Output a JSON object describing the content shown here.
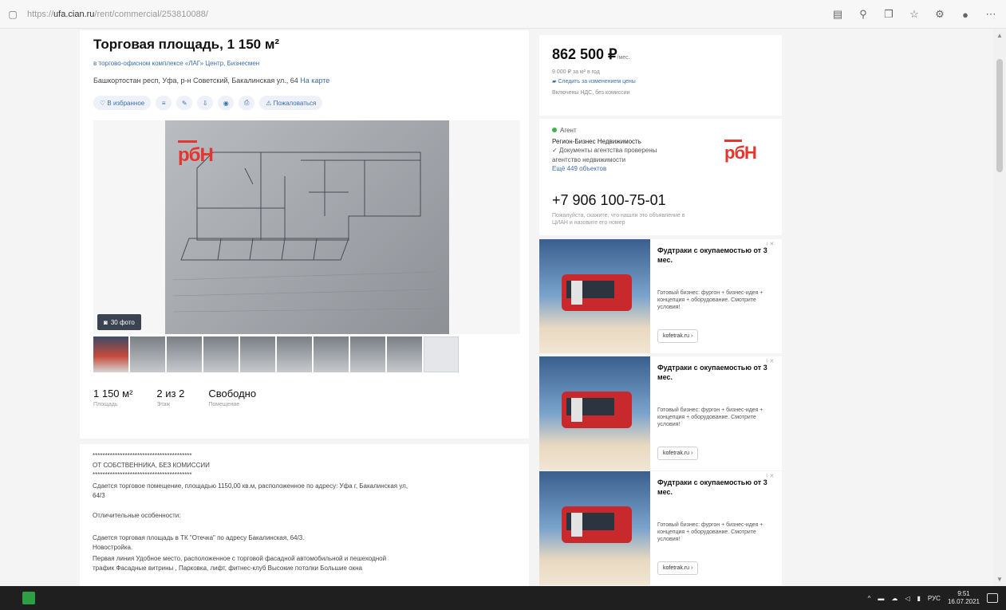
{
  "browser": {
    "url_prefix": "https://",
    "url_domain": "ufa.cian.ru",
    "url_path": "/rent/commercial/253810088/",
    "icons": [
      "reader-icon",
      "zoom-icon",
      "collections-icon",
      "favorite-icon",
      "extensions-icon",
      "profile-icon",
      "more-icon"
    ]
  },
  "listing": {
    "title": "Торговая площадь, 1 150 м²",
    "subtitle_link": "в торгово-офисном комплексе «ЛАГ» Центр, Бизнесмен",
    "address": "Башкортостан респ, Уфа, р-н Советский, Бакалинская ул., 64",
    "map_link": "На карте",
    "actions": {
      "favorite": "В избранное",
      "report": "Пожаловаться"
    },
    "photo_count": "30 фото",
    "stats": [
      {
        "value": "1 150 м²",
        "label": "Площадь"
      },
      {
        "value": "2 из 2",
        "label": "Этаж"
      },
      {
        "value": "Свободно",
        "label": "Помещение"
      }
    ]
  },
  "description": {
    "lines": [
      "****************************************",
      "ОТ СОБСТВЕННИКА, БЕЗ КОМИССИИ",
      "****************************************",
      "Сдается торговое помещение, площадью 1150,00 кв.м, расположенное по адресу: Уфа г, Бакалинская ул,",
      "64/3",
      "Отличительные особенности:",
      "Сдается торговая площадь в ТК \"Отечка\" по адресу Бакалинская, 64/3.",
      "Новостройка.",
      "Первая линия Удобное место, расположенное с торговой фасадной автомобильной и пешеходной",
      "трафик Фасадные витрины , Парковка, лифт, фитнес-клуб Высокие потолки Большие окна"
    ]
  },
  "price": {
    "amount": "862 500 ₽",
    "period": "/мес.",
    "per_meter": "9 000 ₽ за м² в год",
    "history_link": "Следить за изменением цены",
    "tax": "Включены НДС, без комиссии"
  },
  "agent": {
    "status": "Агент",
    "name": "Регион-Бизнес Недвижимость",
    "verified": "✓ Документы агентства проверены",
    "role": "агентство недвижимости",
    "objects_link": "Ещё 449 объектов",
    "logo_text": "рбН",
    "phone": "+7 906 100-75-01",
    "phone_note_1": "Пожалуйста, скажите, что нашли это объявление в",
    "phone_note_2": "ЦИАН и назовите его номер"
  },
  "ads": [
    {
      "title": "Фудтраки с окупаемостью от 3 мес.",
      "text": "Готовый бизнес: фургон + бизнес-идея + концепция + оборудование. Смотрите условия!",
      "button": "kofetrak.ru ›",
      "close": "i ✕"
    },
    {
      "title": "Фудтраки с окупаемостью от 3 мес.",
      "text": "Готовый бизнес: фургон + бизнес-идея + концепция + оборудование. Смотрите условия!",
      "button": "kofetrak.ru ›",
      "close": "i ✕"
    },
    {
      "title": "Фудтраки с окупаемостью от 3 мес.",
      "text": "Готовый бизнес: фургон + бизнес-идея + концепция + оборудование. Смотрите условия!",
      "button": "kofetrak.ru ›",
      "close": "i ✕"
    }
  ],
  "taskbar": {
    "lang": "РУС",
    "time": "9:51",
    "date": "16.07.2021"
  },
  "colors": {
    "brand_red": "#e2362e",
    "link_blue": "#3a6fb0"
  }
}
